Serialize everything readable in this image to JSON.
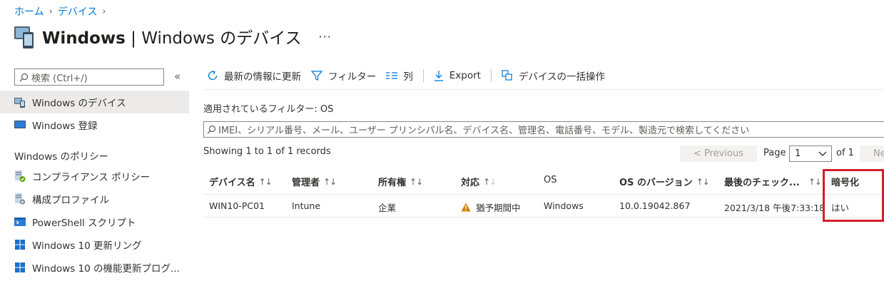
{
  "breadcrumb": {
    "home": "ホーム",
    "devices": "デバイス"
  },
  "header": {
    "title_bold": "Windows",
    "title_rest": " | Windows のデバイス",
    "more": "···"
  },
  "sidebar": {
    "search_placeholder": "検索 (Ctrl+/)",
    "collapse": "«",
    "items": [
      {
        "label": "Windows のデバイス",
        "icon": "devices-icon",
        "active": true
      },
      {
        "label": "Windows 登録",
        "icon": "enrollment-icon",
        "active": false
      }
    ],
    "section_title": "Windows のポリシー",
    "policy_items": [
      {
        "label": "コンプライアンス ポリシー",
        "icon": "compliance-icon"
      },
      {
        "label": "構成プロファイル",
        "icon": "config-profile-icon"
      },
      {
        "label": "PowerShell スクリプト",
        "icon": "powershell-icon"
      },
      {
        "label": "Windows 10 更新リング",
        "icon": "windows-logo-icon"
      },
      {
        "label": "Windows 10 の機能更新プログ...",
        "icon": "windows-logo-icon"
      }
    ]
  },
  "toolbar": {
    "refresh": "最新の情報に更新",
    "filter": "フィルター",
    "columns": "列",
    "export": "Export",
    "bulk": "デバイスの一括操作"
  },
  "filter_applied": "適用されているフィルター: OS",
  "main_search_placeholder": "IMEI、シリアル番号、メール、ユーザー プリンシパル名、デバイス名、管理名、電話番号、モデル、製造元で検索してください",
  "pagination": {
    "showing": "Showing 1 to 1 of 1 records",
    "prev": "< Previous",
    "page_label": "Page",
    "page_value": "1",
    "of_label": "of 1",
    "next": "Ne"
  },
  "table": {
    "columns": [
      "デバイス名",
      "管理者",
      "所有権",
      "対応",
      "OS",
      "OS のバージョン",
      "最後のチェック...",
      "暗号化"
    ],
    "rows": [
      [
        "WIN10-PC01",
        "Intune",
        "企業",
        "猶予期間中",
        "Windows",
        "10.0.19042.867",
        "2021/3/18 午後7:33:18",
        "はい"
      ]
    ]
  },
  "colors": {
    "accent": "#0078d4",
    "highlight": "#d1202a",
    "warning": "#d08000",
    "active_bg": "#edebe9"
  }
}
